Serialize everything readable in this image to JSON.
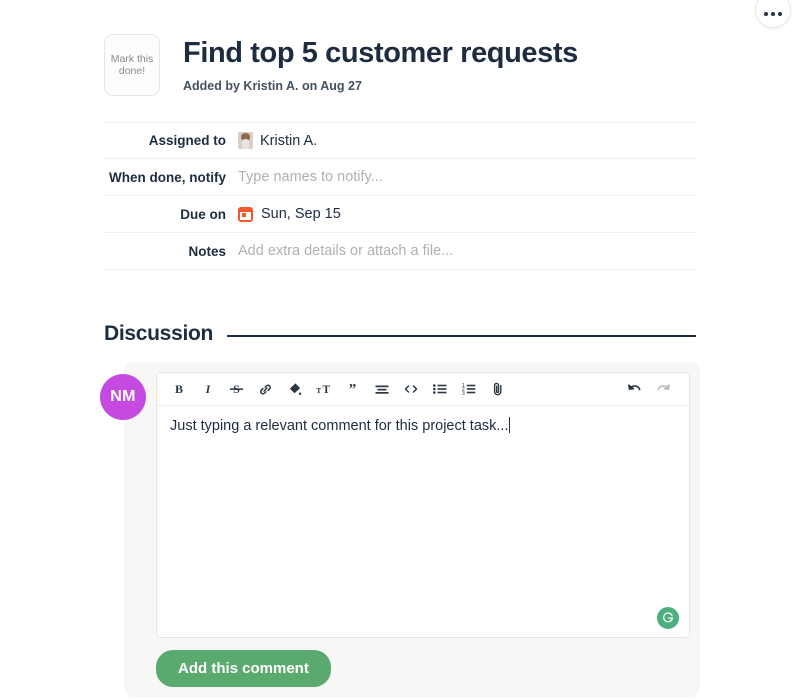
{
  "topbar": {
    "more_button_label": "more-options"
  },
  "header": {
    "mark_done_label": "Mark this done!",
    "title": "Find top 5 customer requests",
    "subtitle": "Added by Kristin A. on Aug 27"
  },
  "meta": {
    "rows": [
      {
        "label": "Assigned to",
        "value": "Kristin A.",
        "icon": "person-avatar-icon",
        "is_placeholder": false
      },
      {
        "label": "When done, notify",
        "value": "Type names to notify...",
        "icon": "",
        "is_placeholder": true
      },
      {
        "label": "Due on",
        "value": "Sun, Sep 15",
        "icon": "calendar-icon",
        "is_placeholder": false
      },
      {
        "label": "Notes",
        "value": "Add extra details or attach a file...",
        "icon": "",
        "is_placeholder": true
      }
    ]
  },
  "discussion": {
    "heading": "Discussion"
  },
  "composer": {
    "avatar_initials": "NM",
    "avatar_color": "#c44ae0",
    "toolbar": [
      {
        "name": "bold-icon",
        "label": "Bold"
      },
      {
        "name": "italic-icon",
        "label": "Italic"
      },
      {
        "name": "strikethrough-icon",
        "label": "Strikethrough"
      },
      {
        "name": "link-icon",
        "label": "Link"
      },
      {
        "name": "highlight-icon",
        "label": "Highlight"
      },
      {
        "name": "font-size-icon",
        "label": "Font size"
      },
      {
        "name": "quote-icon",
        "label": "Quote"
      },
      {
        "name": "heading-lines-icon",
        "label": "Heading"
      },
      {
        "name": "code-icon",
        "label": "Code"
      },
      {
        "name": "bullet-list-icon",
        "label": "Bulleted list"
      },
      {
        "name": "numbered-list-icon",
        "label": "Numbered list"
      },
      {
        "name": "attachment-icon",
        "label": "Attach a file"
      }
    ],
    "undo_label": "Undo",
    "redo_label": "Redo",
    "comment_text": "Just typing a relevant comment for this project task...",
    "grammarly_badge": "G",
    "submit_label": "Add this comment",
    "submit_color": "#5aaa6f"
  }
}
